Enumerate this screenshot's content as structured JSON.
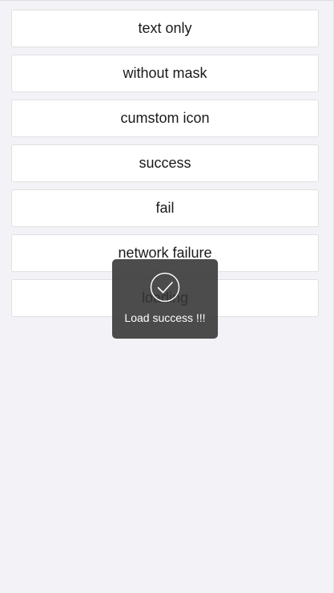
{
  "buttons": [
    {
      "label": "text only"
    },
    {
      "label": "without mask"
    },
    {
      "label": "cumstom icon"
    },
    {
      "label": "success"
    },
    {
      "label": "fail"
    },
    {
      "label": "network failure"
    },
    {
      "label": "loading"
    }
  ],
  "toast": {
    "icon": "checkmark-circle-icon",
    "message": "Load success !!!"
  },
  "colors": {
    "background": "#f3f3f7",
    "button": "#ffffff",
    "toast": "#333333"
  }
}
